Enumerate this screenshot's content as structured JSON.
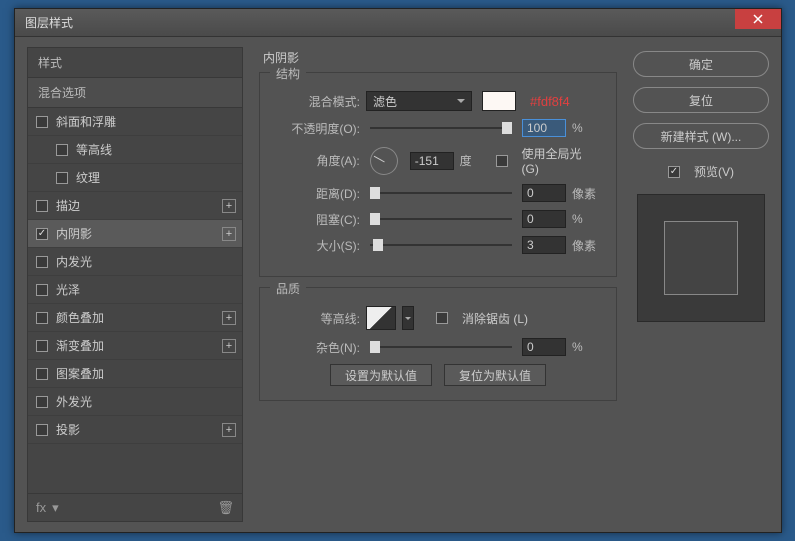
{
  "window": {
    "title": "图层样式"
  },
  "left": {
    "header": "样式",
    "blending": "混合选项",
    "items": [
      {
        "label": "斜面和浮雕",
        "checked": false,
        "plus": false,
        "sub": false
      },
      {
        "label": "等高线",
        "checked": false,
        "plus": false,
        "sub": true
      },
      {
        "label": "纹理",
        "checked": false,
        "plus": false,
        "sub": true
      },
      {
        "label": "描边",
        "checked": false,
        "plus": true,
        "sub": false
      },
      {
        "label": "内阴影",
        "checked": true,
        "plus": true,
        "sub": false,
        "selected": true
      },
      {
        "label": "内发光",
        "checked": false,
        "plus": false,
        "sub": false
      },
      {
        "label": "光泽",
        "checked": false,
        "plus": false,
        "sub": false
      },
      {
        "label": "颜色叠加",
        "checked": false,
        "plus": true,
        "sub": false
      },
      {
        "label": "渐变叠加",
        "checked": false,
        "plus": true,
        "sub": false
      },
      {
        "label": "图案叠加",
        "checked": false,
        "plus": false,
        "sub": false
      },
      {
        "label": "外发光",
        "checked": false,
        "plus": false,
        "sub": false
      },
      {
        "label": "投影",
        "checked": false,
        "plus": true,
        "sub": false
      }
    ]
  },
  "mid": {
    "title": "内阴影",
    "structure": {
      "legend": "结构",
      "blend_label": "混合模式:",
      "blend_value": "滤色",
      "color_note": "#fdf8f4",
      "opacity_label": "不透明度(O):",
      "opacity_value": "100",
      "opacity_unit": "%",
      "angle_label": "角度(A):",
      "angle_value": "-151",
      "angle_unit": "度",
      "global_label": "使用全局光 (G)",
      "distance_label": "距离(D):",
      "distance_value": "0",
      "distance_unit": "像素",
      "choke_label": "阻塞(C):",
      "choke_value": "0",
      "choke_unit": "%",
      "size_label": "大小(S):",
      "size_value": "3",
      "size_unit": "像素"
    },
    "quality": {
      "legend": "品质",
      "contour_label": "等高线:",
      "aa_label": "消除锯齿 (L)",
      "noise_label": "杂色(N):",
      "noise_value": "0",
      "noise_unit": "%"
    },
    "buttons": {
      "default": "设置为默认值",
      "reset": "复位为默认值"
    }
  },
  "right": {
    "ok": "确定",
    "cancel": "复位",
    "newstyle": "新建样式 (W)...",
    "preview_label": "预览(V)"
  }
}
